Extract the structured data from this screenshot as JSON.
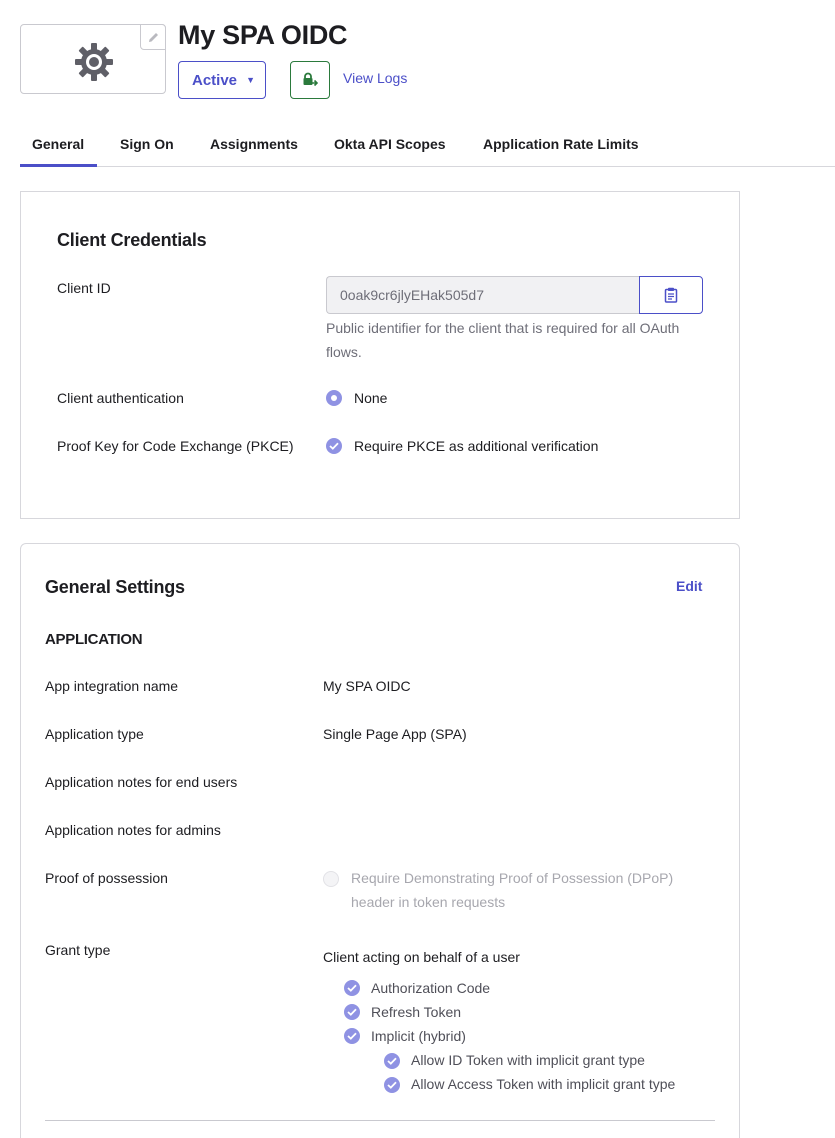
{
  "header": {
    "app_title": "My SPA OIDC",
    "status_label": "Active",
    "view_logs_label": "View Logs",
    "accent_color": "#4b4fc8",
    "icons": [
      "gear-icon",
      "pencil-icon",
      "chevron-down-icon",
      "lock-push-icon",
      "clipboard-icon",
      "check-icon"
    ]
  },
  "tabs": [
    {
      "label": "General",
      "active": true
    },
    {
      "label": "Sign On",
      "active": false
    },
    {
      "label": "Assignments",
      "active": false
    },
    {
      "label": "Okta API Scopes",
      "active": false
    },
    {
      "label": "Application Rate Limits",
      "active": false
    }
  ],
  "client_credentials": {
    "title": "Client Credentials",
    "client_id_label": "Client ID",
    "client_id_value": "0oak9cr6jlyEHak505d7",
    "client_id_help": "Public identifier for the client that is required for all OAuth flows.",
    "client_auth_label": "Client authentication",
    "client_auth_value": "None",
    "pkce_label": "Proof Key for Code Exchange (PKCE)",
    "pkce_value": "Require PKCE as additional verification"
  },
  "general_settings": {
    "title": "General Settings",
    "edit_label": "Edit",
    "section_title": "APPLICATION",
    "rows": {
      "name_label": "App integration name",
      "name_value": "My SPA OIDC",
      "type_label": "Application type",
      "type_value": "Single Page App (SPA)",
      "end_user_notes_label": "Application notes for end users",
      "admin_notes_label": "Application notes for admins",
      "pop_label": "Proof of possession",
      "pop_value_line1": "Require Demonstrating Proof of Possession (DPoP)",
      "pop_value_line2": "header in token requests",
      "grant_type_label": "Grant type"
    },
    "grant_types": {
      "heading": "Client acting on behalf of a user",
      "authorization_code": "Authorization Code",
      "refresh_token": "Refresh Token",
      "implicit": "Implicit (hybrid)",
      "allow_id_token": "Allow ID Token with implicit grant type",
      "allow_access_token": "Allow Access Token with implicit grant type"
    }
  }
}
